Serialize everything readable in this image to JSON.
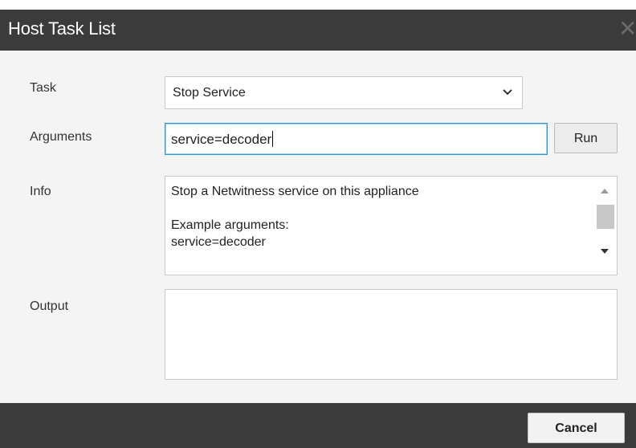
{
  "dialog": {
    "title": "Host Task List",
    "close_icon": "close-icon"
  },
  "form": {
    "task_label": "Task",
    "task_selected": "Stop Service",
    "arguments_label": "Arguments",
    "arguments_value": "service=decoder",
    "run_label": "Run",
    "info_label": "Info",
    "info_text": "Stop a Netwitness service on this appliance\n\nExample arguments:\nservice=decoder",
    "output_label": "Output",
    "output_value": ""
  },
  "footer": {
    "cancel_label": "Cancel"
  },
  "colors": {
    "titlebar": "#3b3b3b",
    "dialog_background": "#f4f4f4",
    "focus_border": "#2f93d7"
  }
}
